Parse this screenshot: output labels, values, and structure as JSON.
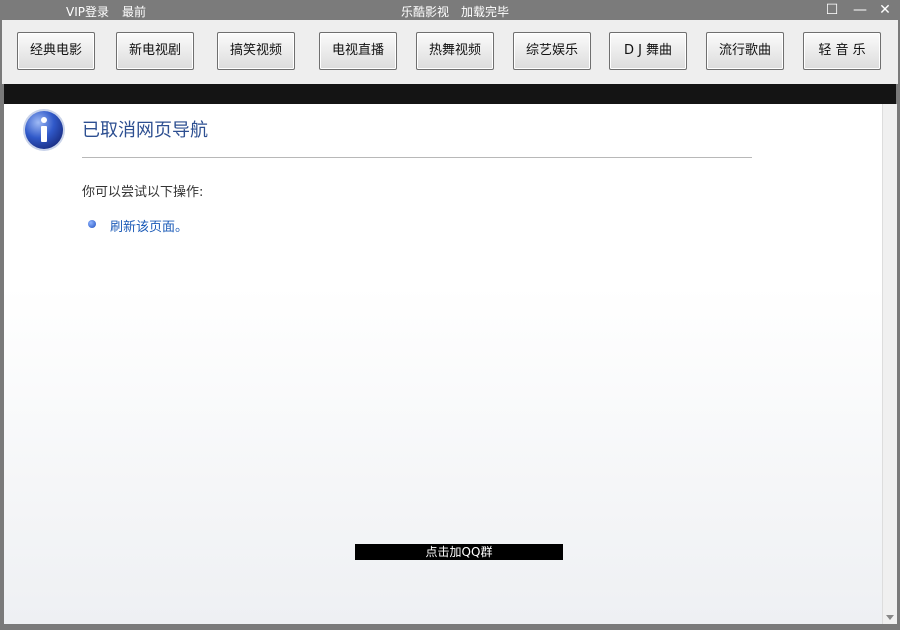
{
  "titlebar": {
    "vip_login": "VIP登录",
    "topmost": "最前",
    "app_title": "乐酷影视",
    "status": "加载完毕",
    "maximize_glyph": "☐",
    "minimize_glyph": "—",
    "close_glyph": "✕"
  },
  "nav": {
    "items": [
      {
        "label": "经典电影"
      },
      {
        "label": "新电视剧"
      },
      {
        "label": "搞笑视频"
      },
      {
        "label": "电视直播"
      },
      {
        "label": "热舞视频"
      },
      {
        "label": "综艺娱乐"
      },
      {
        "label": "D J 舞曲"
      },
      {
        "label": "流行歌曲"
      },
      {
        "label": "轻 音 乐"
      }
    ]
  },
  "page": {
    "heading": "已取消网页导航",
    "hint": "你可以尝试以下操作:",
    "refresh_link": "刷新该页面。",
    "icon": "info-icon"
  },
  "footer": {
    "qq_group": "点击加QQ群"
  },
  "colors": {
    "titlebar_bg": "#7b7b7b",
    "heading": "#2d4f91",
    "link": "#1d5cb8"
  }
}
